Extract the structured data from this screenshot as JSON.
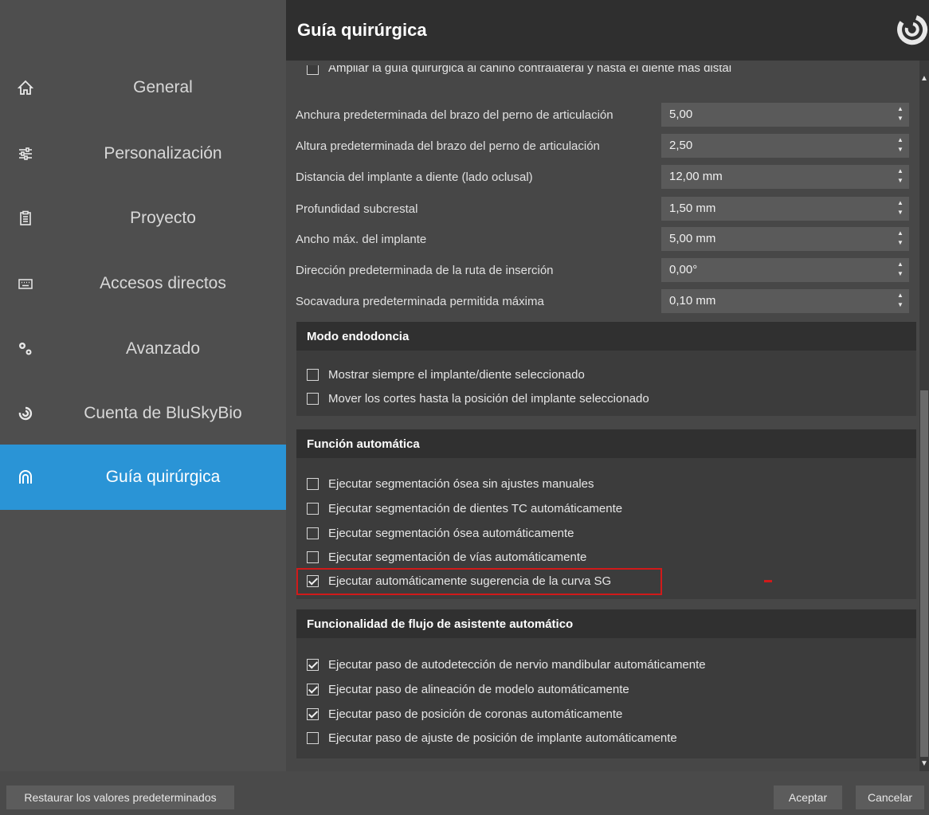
{
  "sidebar": {
    "items": [
      {
        "label": "General",
        "icon": "home-icon"
      },
      {
        "label": "Personalización",
        "icon": "sliders-icon"
      },
      {
        "label": "Proyecto",
        "icon": "clipboard-icon"
      },
      {
        "label": "Accesos directos",
        "icon": "keyboard-icon"
      },
      {
        "label": "Avanzado",
        "icon": "gears-icon"
      },
      {
        "label": "Cuenta de BluSkyBio",
        "icon": "bluskybio-icon"
      },
      {
        "label": "Guía quirúrgica",
        "icon": "arch-icon",
        "active": true
      }
    ]
  },
  "header": {
    "title": "Guía quirúrgica",
    "logo": "bluskybio-logo"
  },
  "content": {
    "top_partial_checkbox": {
      "label": "Ampliar la guía quirúrgica al canino contralateral y hasta el diente más distal",
      "checked": false
    },
    "fields": [
      {
        "label": "Anchura predeterminada del brazo del perno de articulación",
        "value": "5,00"
      },
      {
        "label": "Altura predeterminada del brazo del perno de articulación",
        "value": "2,50"
      },
      {
        "label": "Distancia del implante a diente (lado oclusal)",
        "value": "12,00 mm"
      },
      {
        "label": "Profundidad subcrestal",
        "value": "1,50 mm"
      },
      {
        "label": "Ancho máx. del implante",
        "value": "5,00 mm"
      },
      {
        "label": "Dirección predeterminada de la ruta de inserción",
        "value": "0,00°"
      },
      {
        "label": "Socavadura predeterminada permitida máxima",
        "value": "0,10 mm"
      }
    ],
    "sections": [
      {
        "title": "Modo endodoncia",
        "items": [
          {
            "label": "Mostrar siempre el implante/diente seleccionado",
            "checked": false
          },
          {
            "label": "Mover los cortes hasta la posición del implante seleccionado",
            "checked": false
          }
        ]
      },
      {
        "title": "Función automática",
        "items": [
          {
            "label": "Ejecutar segmentación ósea sin ajustes manuales",
            "checked": false
          },
          {
            "label": "Ejecutar segmentación de dientes TC automáticamente",
            "checked": false
          },
          {
            "label": "Ejecutar segmentación ósea automáticamente",
            "checked": false
          },
          {
            "label": "Ejecutar segmentación de vías automáticamente",
            "checked": false
          },
          {
            "label": "Ejecutar automáticamente sugerencia de la curva SG",
            "checked": true,
            "highlighted": true
          }
        ]
      },
      {
        "title": "Funcionalidad de flujo de asistente automático",
        "items": [
          {
            "label": "Ejecutar paso de autodetección de nervio mandibular automáticamente",
            "checked": true
          },
          {
            "label": "Ejecutar paso de alineación de modelo automáticamente",
            "checked": true
          },
          {
            "label": "Ejecutar paso de posición de coronas automáticamente",
            "checked": true
          },
          {
            "label": "Ejecutar paso de ajuste de posición de implante automáticamente",
            "checked": false
          }
        ]
      }
    ]
  },
  "footer": {
    "restore_label": "Restaurar los valores predeterminados",
    "accept_label": "Aceptar",
    "cancel_label": "Cancelar"
  },
  "colors": {
    "active": "#2a94d6",
    "highlight": "#d11a1a",
    "header": "#2f2f2f"
  }
}
